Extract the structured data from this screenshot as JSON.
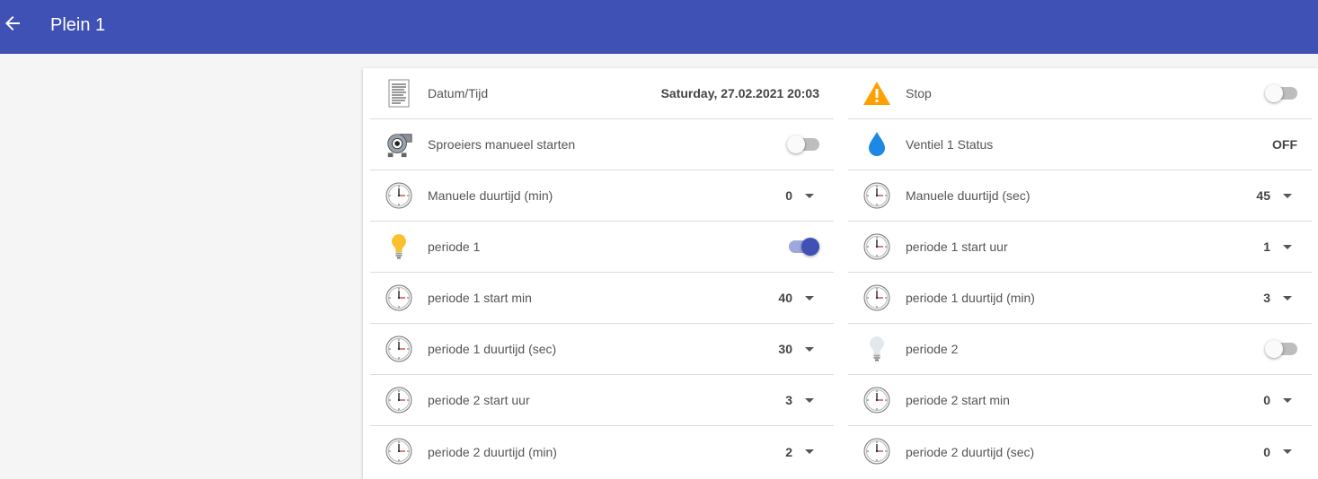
{
  "appbar": {
    "title": "Plein 1",
    "color": "#3f51b5"
  },
  "left": [
    {
      "label": "Datum/Tijd",
      "kind": "text",
      "value": "Saturday, 27.02.2021 20:03",
      "icon": "document-icon"
    },
    {
      "label": "Sproeiers manueel starten",
      "kind": "toggle",
      "on": false,
      "icon": "pump-icon"
    },
    {
      "label": "Manuele duurtijd (min)",
      "kind": "select",
      "value": "0",
      "icon": "clock-icon"
    },
    {
      "label": "periode 1",
      "kind": "toggle",
      "on": true,
      "icon": "bulb-on-icon"
    },
    {
      "label": "periode 1 start min",
      "kind": "select",
      "value": "40",
      "icon": "clock-icon"
    },
    {
      "label": "periode 1 duurtijd (sec)",
      "kind": "select",
      "value": "30",
      "icon": "clock-icon"
    },
    {
      "label": "periode 2 start uur",
      "kind": "select",
      "value": "3",
      "icon": "clock-icon"
    },
    {
      "label": "periode 2 duurtijd (min)",
      "kind": "select",
      "value": "2",
      "icon": "clock-icon"
    }
  ],
  "right": [
    {
      "label": "Stop",
      "kind": "toggle",
      "on": false,
      "icon": "warning-icon"
    },
    {
      "label": "Ventiel 1 Status",
      "kind": "text",
      "value": "OFF",
      "icon": "water-drop-icon"
    },
    {
      "label": "Manuele duurtijd (sec)",
      "kind": "select",
      "value": "45",
      "icon": "clock-icon"
    },
    {
      "label": "periode 1 start uur",
      "kind": "select",
      "value": "1",
      "icon": "clock-icon"
    },
    {
      "label": "periode 1 duurtijd (min)",
      "kind": "select",
      "value": "3",
      "icon": "clock-icon"
    },
    {
      "label": "periode 2",
      "kind": "toggle",
      "on": false,
      "icon": "bulb-off-icon"
    },
    {
      "label": "periode 2 start min",
      "kind": "select",
      "value": "0",
      "icon": "clock-icon"
    },
    {
      "label": "periode 2 duurtijd (sec)",
      "kind": "select",
      "value": "0",
      "icon": "clock-icon"
    }
  ]
}
